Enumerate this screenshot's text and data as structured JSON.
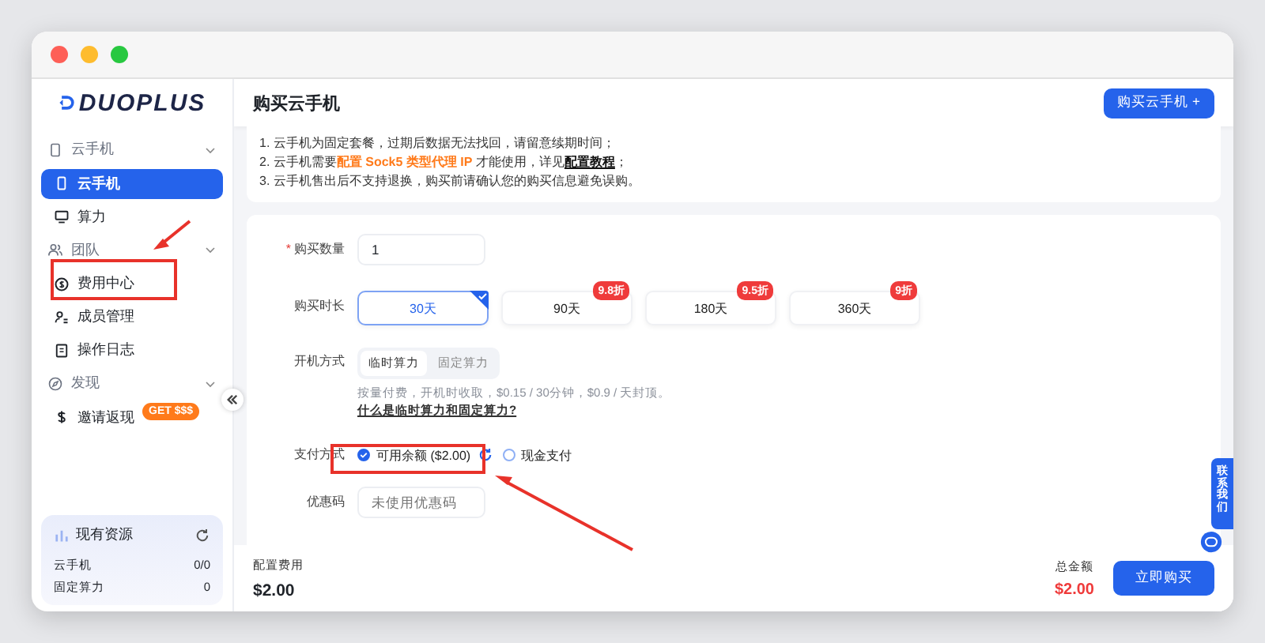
{
  "logo": {
    "text": "DUOPLUS"
  },
  "sidebar": {
    "groups": [
      {
        "label": "云手机",
        "expanded": true,
        "children": [
          {
            "label": "云手机",
            "selected": true
          },
          {
            "label": "算力",
            "selected": false
          }
        ]
      },
      {
        "label": "团队",
        "expanded": true,
        "children": [
          {
            "label": "费用中心",
            "selected": false
          },
          {
            "label": "成员管理",
            "selected": false
          },
          {
            "label": "操作日志",
            "selected": false
          }
        ]
      },
      {
        "label": "发现",
        "expanded": true,
        "children": [
          {
            "label": "邀请返现",
            "selected": false,
            "badge": "GET $$$"
          }
        ]
      }
    ],
    "resources": {
      "title": "现有资源",
      "rows": [
        {
          "label": "云手机",
          "value": "0/0"
        },
        {
          "label": "固定算力",
          "value": "0"
        }
      ]
    }
  },
  "header": {
    "title": "购买云手机",
    "button": "购买云手机 +"
  },
  "notice": {
    "lines": [
      [
        {
          "kind": "plain",
          "text": "1. 云手机为固定套餐，过期后数据无法找回，请留意续期时间；"
        }
      ],
      [
        {
          "kind": "plain",
          "text": "2. 云手机需要"
        },
        {
          "kind": "highlight",
          "text": "配置 Sock5 类型代理 IP"
        },
        {
          "kind": "plain",
          "text": " 才能使用，详见"
        },
        {
          "kind": "link",
          "text": "配置教程"
        },
        {
          "kind": "plain",
          "text": "；"
        }
      ],
      [
        {
          "kind": "plain",
          "text": "3. 云手机售出后不支持退换，购买前请确认您的购买信息避免误购。"
        }
      ]
    ]
  },
  "form": {
    "quantity": {
      "label": "购买数量",
      "required_mark": "*",
      "value": "1"
    },
    "duration": {
      "label": "购买时长",
      "options": [
        {
          "label": "30天",
          "selected": true
        },
        {
          "label": "90天",
          "selected": false,
          "badge": "9.8折"
        },
        {
          "label": "180天",
          "selected": false,
          "badge": "9.5折"
        },
        {
          "label": "360天",
          "selected": false,
          "badge": "9折"
        }
      ]
    },
    "boot_mode": {
      "label": "开机方式",
      "options": [
        {
          "label": "临时算力",
          "selected": true
        },
        {
          "label": "固定算力",
          "selected": false
        }
      ],
      "description": "按量付费，开机时收取，$0.15 / 30分钟，$0.9 / 天封顶。",
      "link": "什么是临时算力和固定算力?"
    },
    "payment": {
      "label": "支付方式",
      "options": [
        {
          "label": "可用余额 ($2.00)",
          "selected": true,
          "refresh": true
        },
        {
          "label": "现金支付",
          "selected": false,
          "refresh": false
        }
      ]
    },
    "coupon": {
      "label": "优惠码",
      "placeholder": "未使用优惠码"
    }
  },
  "footer": {
    "config_label": "配置费用",
    "config_value": "$2.00",
    "total_label": "总金额",
    "total_value": "$2.00",
    "button": "立即购买"
  },
  "contact": {
    "text": "联系我们"
  }
}
